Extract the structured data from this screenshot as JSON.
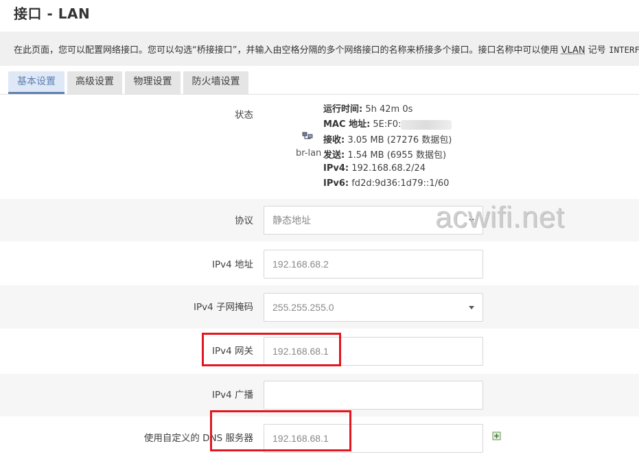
{
  "page": {
    "title": "接口 - LAN",
    "description_prefix": "在此页面，您可以配置网络接口。您可以勾选“桥接接口”，并输入由空格分隔的多个网络接口的名称来桥接多个接口。接口名称中可以使用 ",
    "description_vlan": "VLAN",
    "description_mid": " 记号 ",
    "description_code": "INTERFACE"
  },
  "tabs": [
    "基本设置",
    "高级设置",
    "物理设置",
    "防火墙设置"
  ],
  "status": {
    "label": "状态",
    "interface": "br-lan",
    "icon": "network-interface-icon",
    "uptime_key": "运行时间:",
    "uptime": "5h 42m 0s",
    "mac_key": "MAC 地址:",
    "mac": "5E:F0:",
    "rx_key": "接收:",
    "rx": "3.05 MB (27276 数据包)",
    "tx_key": "发送:",
    "tx": "1.54 MB (6955 数据包)",
    "ipv4_key": "IPv4:",
    "ipv4": "192.168.68.2/24",
    "ipv6_key": "IPv6:",
    "ipv6": "fd2d:9d36:1d79::1/60"
  },
  "form": {
    "protocol": {
      "label": "协议",
      "value": "静态地址"
    },
    "ipv4_addr": {
      "label": "IPv4 地址",
      "value": "192.168.68.2"
    },
    "netmask": {
      "label": "IPv4 子网掩码",
      "value": "255.255.255.0"
    },
    "gateway": {
      "label": "IPv4 网关",
      "value": "192.168.68.1"
    },
    "broadcast": {
      "label": "IPv4 广播",
      "value": ""
    },
    "dns": {
      "label": "使用自定义的 DNS 服务器",
      "value": "192.168.68.1"
    }
  },
  "watermark": "acwifi.net",
  "colors": {
    "tab_active": "#5d7fae",
    "highlight": "#e2161e"
  }
}
